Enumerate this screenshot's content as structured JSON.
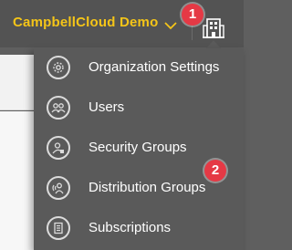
{
  "header": {
    "org_name": "CampbellCloud Demo",
    "org_dropdown_icon": "chevron-down-icon",
    "org_switch_icon": "building-icon",
    "accent_color": "#f5c518"
  },
  "callouts": {
    "step1": "1",
    "step2": "2",
    "color": "#e53945"
  },
  "menu": {
    "items": [
      {
        "label": "Organization Settings",
        "icon": "gear-icon"
      },
      {
        "label": "Users",
        "icon": "users-icon"
      },
      {
        "label": "Security Groups",
        "icon": "security-group-icon"
      },
      {
        "label": "Distribution Groups",
        "icon": "distribution-group-icon"
      },
      {
        "label": "Subscriptions",
        "icon": "subscriptions-icon"
      }
    ]
  }
}
